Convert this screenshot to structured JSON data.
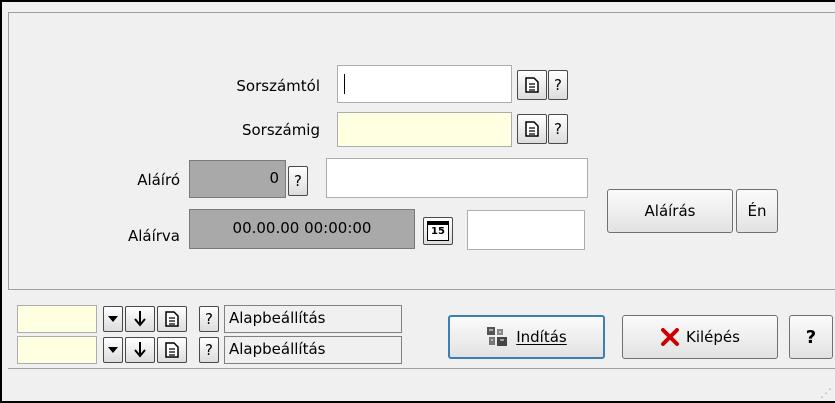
{
  "form": {
    "sorszamtol_label": "Sorszámtól",
    "sorszamtol_value": "",
    "sorszamig_label": "Sorszámig",
    "sorszamig_value": "",
    "help_glyph": "?",
    "alairo_label": "Aláíró",
    "alairo_value": "0",
    "alairo_name_value": "",
    "alairva_label": "Aláírva",
    "alairva_value": "00.00.00 00:00:00",
    "alairva_extra_value": "",
    "calendar_day": "15",
    "alairas_button": "Aláírás",
    "en_button": "Én"
  },
  "bottom": {
    "rows": [
      {
        "value": "",
        "preset": "Alapbeállítás"
      },
      {
        "value": "",
        "preset": "Alapbeállítás"
      }
    ],
    "inditas_button": "Indítás",
    "kilepes_button": "Kilépés",
    "help_button": "?"
  },
  "icons": [
    "document-icon",
    "dropdown-arrow-icon",
    "down-arrow-icon",
    "calendar-icon",
    "run-icon",
    "close-x-icon"
  ],
  "colors": {
    "required_field": "#ffffe1",
    "disabled_field": "#a9a9a9",
    "default_button_border": "#3c7fb1",
    "exit_x": "#cc0000"
  }
}
